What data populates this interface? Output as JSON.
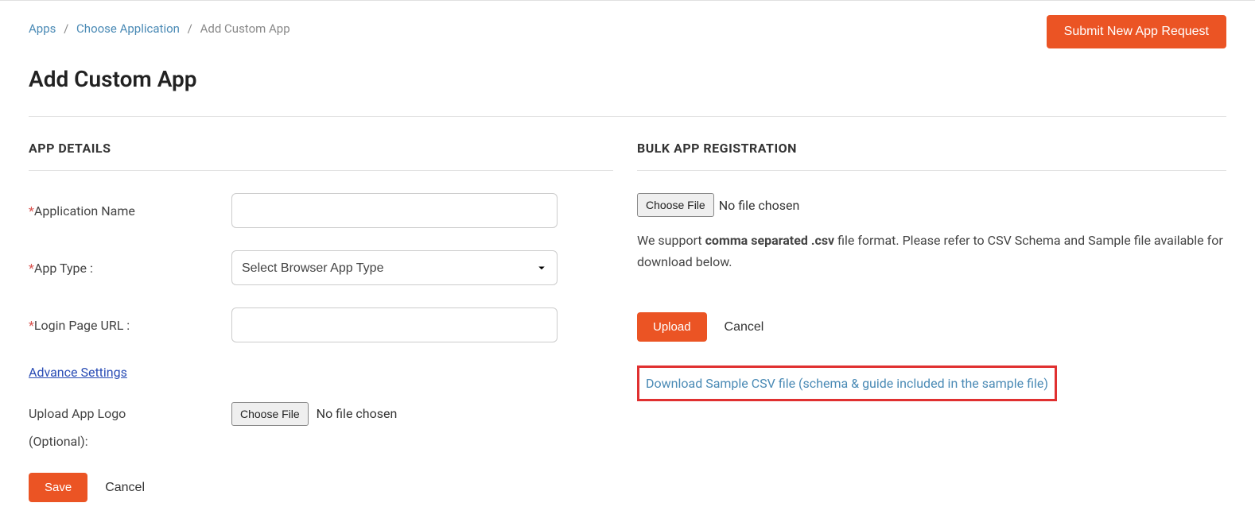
{
  "breadcrumb": {
    "item1": "Apps",
    "item2": "Choose Application",
    "current": "Add Custom App"
  },
  "header": {
    "submit_request_label": "Submit New App Request"
  },
  "page_title": "Add Custom App",
  "app_details": {
    "section_title": "APP DETAILS",
    "application_name_label": "Application Name",
    "app_type_label": "App Type :",
    "app_type_placeholder": "Select Browser App Type",
    "login_url_label": "Login Page URL :",
    "advance_settings_label": "Advance Settings",
    "upload_logo_label": "Upload App Logo",
    "choose_file_label": "Choose File",
    "no_file_chosen": "No file chosen",
    "optional_label": "(Optional):",
    "save_label": "Save",
    "cancel_label": "Cancel"
  },
  "bulk": {
    "section_title": "BULK APP REGISTRATION",
    "choose_file_label": "Choose File",
    "no_file_chosen": "No file chosen",
    "help_pre": "We support ",
    "help_strong": "comma separated .csv",
    "help_post": " file format. Please refer to CSV Schema and Sample file available for download below.",
    "upload_label": "Upload",
    "cancel_label": "Cancel",
    "download_link": "Download Sample CSV file (schema & guide included in the sample file)"
  }
}
